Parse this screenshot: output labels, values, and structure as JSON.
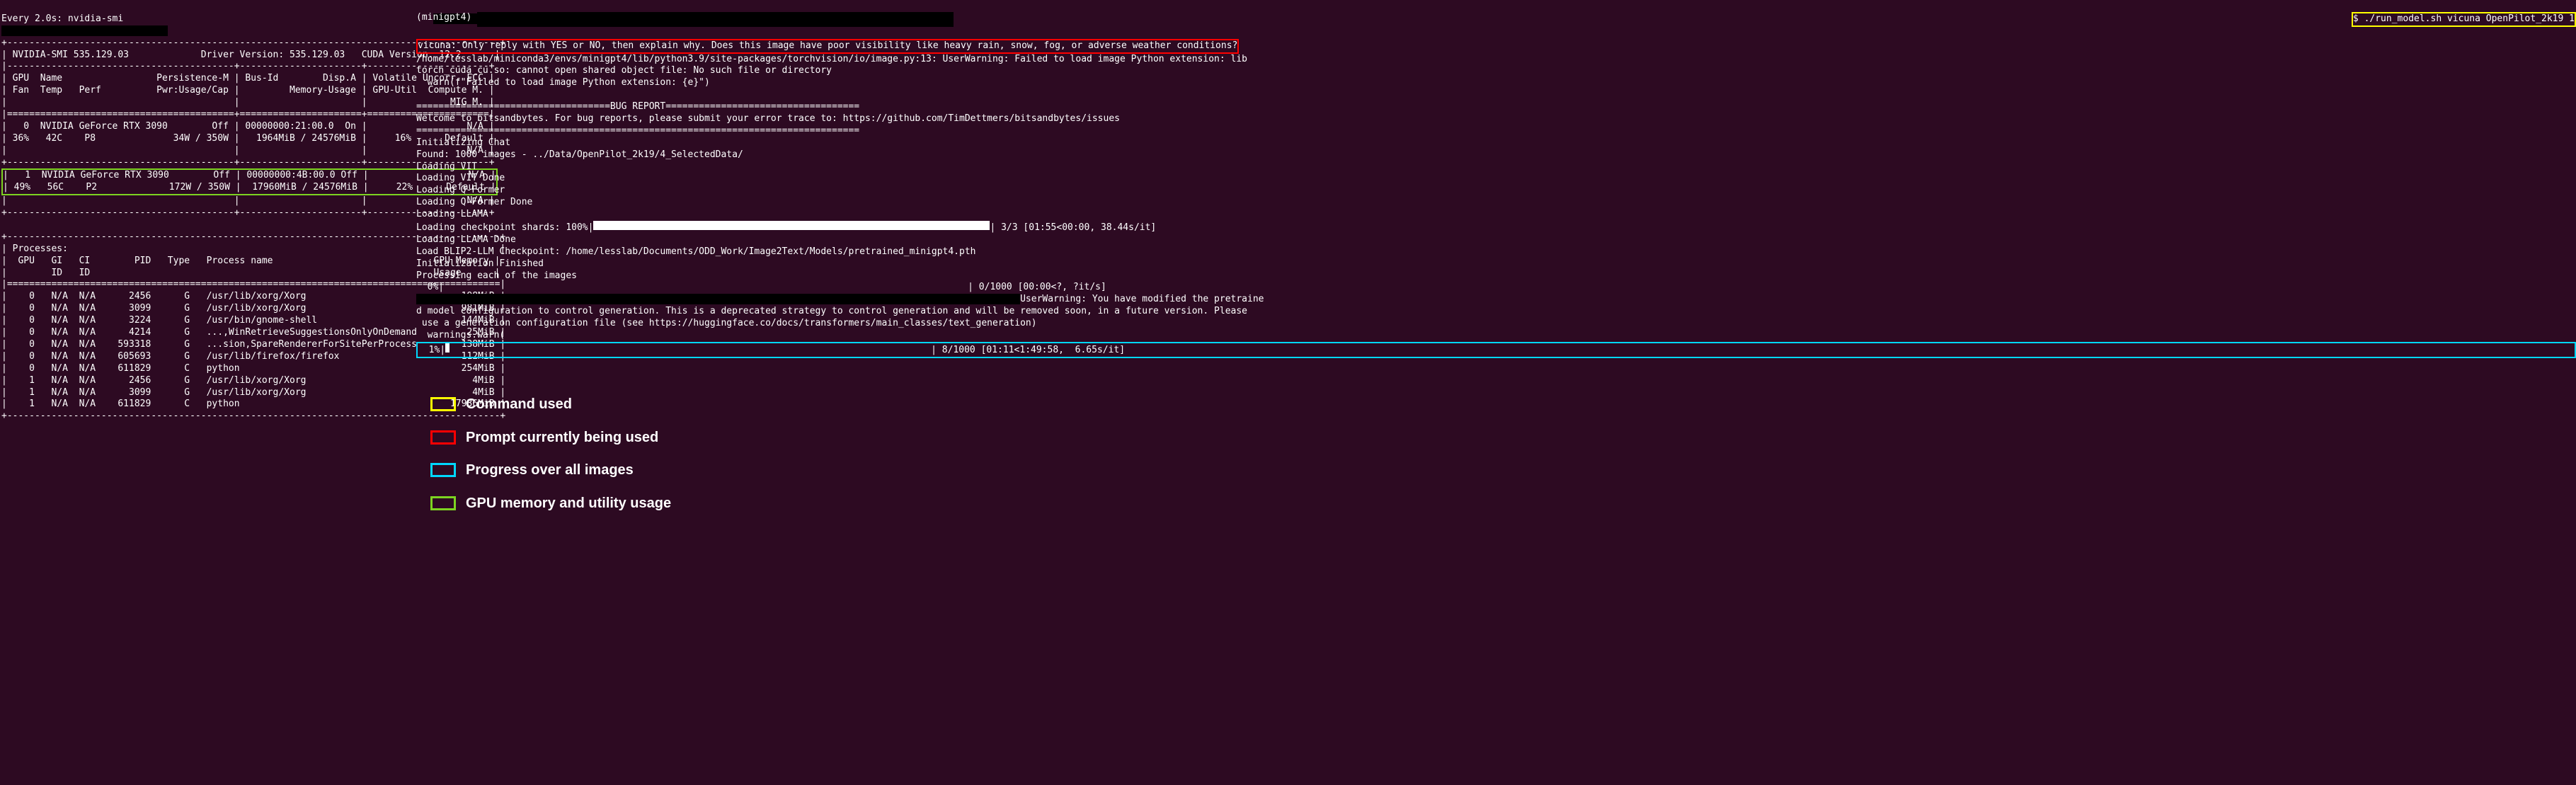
{
  "left": {
    "watch_header": "Every 2.0s: nvidia-smi",
    "redact1": "XXXXXXXXXXXXXXXXXXXXXXXX",
    "redact2": "XXXXXXXXXXXXXXXXXXXXXXXXXXXXXX",
    "divider_top": "+-----------------------------------------------------------------------------------------+",
    "driver_row": "| NVIDIA-SMI 535.129.03             Driver Version: 535.129.03   CUDA Version: 12.2      |",
    "divider_h": "|-----------------------------------------+----------------------+----------------------+",
    "hdr1": "| GPU  Name                 Persistence-M | Bus-Id        Disp.A | Volatile Uncorr. ECC |",
    "hdr2": "| Fan  Temp   Perf          Pwr:Usage/Cap |         Memory-Usage | GPU-Util  Compute M. |",
    "hdr3": "|                                         |                      |               MIG M. |",
    "divider_eq": "|=========================================+======================+======================|",
    "gpu0_r1": "|   0  NVIDIA GeForce RTX 3090        Off | 00000000:21:00.0  On |                  N/A |",
    "gpu0_r2": "| 36%   42C    P8              34W / 350W |   1964MiB / 24576MiB |     16%      Default |",
    "gpu0_r3": "|                                         |                      |                  N/A |",
    "divider_mid": "+-----------------------------------------+----------------------+----------------------+",
    "gpu1_r1": "|   1  NVIDIA GeForce RTX 3090        Off | 00000000:4B:00.0 Off |                  N/A |",
    "gpu1_r2": "| 49%   56C    P2             172W / 350W |  17960MiB / 24576MiB |     22%      Default |",
    "gpu1_r3": "|                                         |                      |                  N/A |",
    "divider_bot": "+-----------------------------------------+----------------------+----------------------+",
    "proc_top": "+-----------------------------------------------------------------------------------------+",
    "proc_h1": "| Processes:                                                                              |",
    "proc_h2": "|  GPU   GI   CI        PID   Type   Process name                             GPU Memory |",
    "proc_h3": "|        ID   ID                                                              Usage      |",
    "proc_div": "|=========================================================================================|",
    "p0": "|    0   N/A  N/A      2456      G   /usr/lib/xorg/Xorg                            198MiB |",
    "p1": "|    0   N/A  N/A      3099      G   /usr/lib/xorg/Xorg                            981MiB |",
    "p2": "|    0   N/A  N/A      3224      G   /usr/bin/gnome-shell                          144MiB |",
    "p3": "|    0   N/A  N/A      4214      G   ...,WinRetrieveSuggestionsOnlyOnDemand         25MiB |",
    "p4": "|    0   N/A  N/A    593318      G   ...sion,SpareRendererForSitePerProcess        138MiB |",
    "p5": "|    0   N/A  N/A    605693      G   /usr/lib/firefox/firefox                      112MiB |",
    "p6": "|    0   N/A  N/A    611829      C   python                                        254MiB |",
    "p7": "|    1   N/A  N/A      2456      G   /usr/lib/xorg/Xorg                              4MiB |",
    "p8": "|    1   N/A  N/A      3099      G   /usr/lib/xorg/Xorg                              4MiB |",
    "p9": "|    1   N/A  N/A    611829      C   python                                      17936MiB |",
    "proc_end": "+-----------------------------------------------------------------------------------------+"
  },
  "right": {
    "env": "(minigpt4) ",
    "redact_env": "XXXXXXXXXXXXXXXXXXXXXXXXXXXXXXXXXXXXXXXXXXXXXXXXXXXXXXXXXXXXXXXXXXXXXXXXXXXXXXXXXXXXXX",
    "cmd": "$ ./run_model.sh vicuna OpenPilot_2k19 1",
    "prompt": "vicuna: Only reply with YES or NO, then explain why. Does this image have poor visibility like heavy rain, snow, fog, or adverse weather conditions?",
    "warn1": "/home/lesslab/miniconda3/envs/minigpt4/lib/python3.9/site-packages/torchvision/io/image.py:13: UserWarning: Failed to load image Python extension: lib",
    "warn2": "torch_cuda_cu.so: cannot open shared object file: No such file or directory",
    "warn3": "  warn(f\"Failed to load image Python extension: {e}\")",
    "bug1": "===================================BUG REPORT===================================",
    "bug2": "Welcome to bitsandbytes. For bug reports, please submit your error trace to: https://github.com/TimDettmers/bitsandbytes/issues",
    "bug3": "================================================================================",
    "init": "Initializing Chat",
    "found": "Found: 1000 images - ../Data/OpenPilot_2k19/4_SelectedData/",
    "lv1": "Loading VIT",
    "lv2": "Loading VIT Done",
    "lq1": "Loading Q-Former",
    "lq2": "Loading Q-Former Done",
    "ll1": "Loading LLAMA",
    "shards_pre": "Loading checkpoint shards: 100%|",
    "shards_post": "| 3/3 [01:55<00:00, 38.44s/it]",
    "ll2": "Loading LLAMA Done",
    "blip": "Load BLIP2-LLM Checkpoint: /home/lesslab/Documents/ODD_Work/Image2Text/Models/pretrained_minigpt4.pth",
    "initf": "Initialization Finished",
    "proc_each": "Processing each of the images",
    "pg0_pre": "  0%|",
    "pg0_post": "| 0/1000 [00:00<?, ?it/s]",
    "redact_mid": "XXXXXXXXXXXXXXXXXXXXXXXXXXXXXXXXXXXXXXXXXXXXXXXXXXXXXXXXXXXXXXXXXXXXXXXXXXXXXXXXXXXXXXXXXXXXXXXXXXXXXXXXXXXXX",
    "uw_pre": "UserWarning: You have modified the pretraine",
    "uw1": "d model configuration to control generation. This is a deprecated strategy to control generation and will be removed soon, in a future version. Please",
    "uw2": " use a generation configuration file (see https://huggingface.co/docs/transformers/main_classes/text_generation)",
    "uw3": "  warnings.warn(",
    "pg1_pre": "  1%|",
    "pg1_bar": "|",
    "pg1_post": "| 8/1000 [01:11<1:49:58,  6.65s/it]"
  },
  "legend": {
    "l1": "Command used",
    "l2": "Prompt currently being used",
    "l3": "Progress over all images",
    "l4": "GPU memory and utility usage"
  }
}
